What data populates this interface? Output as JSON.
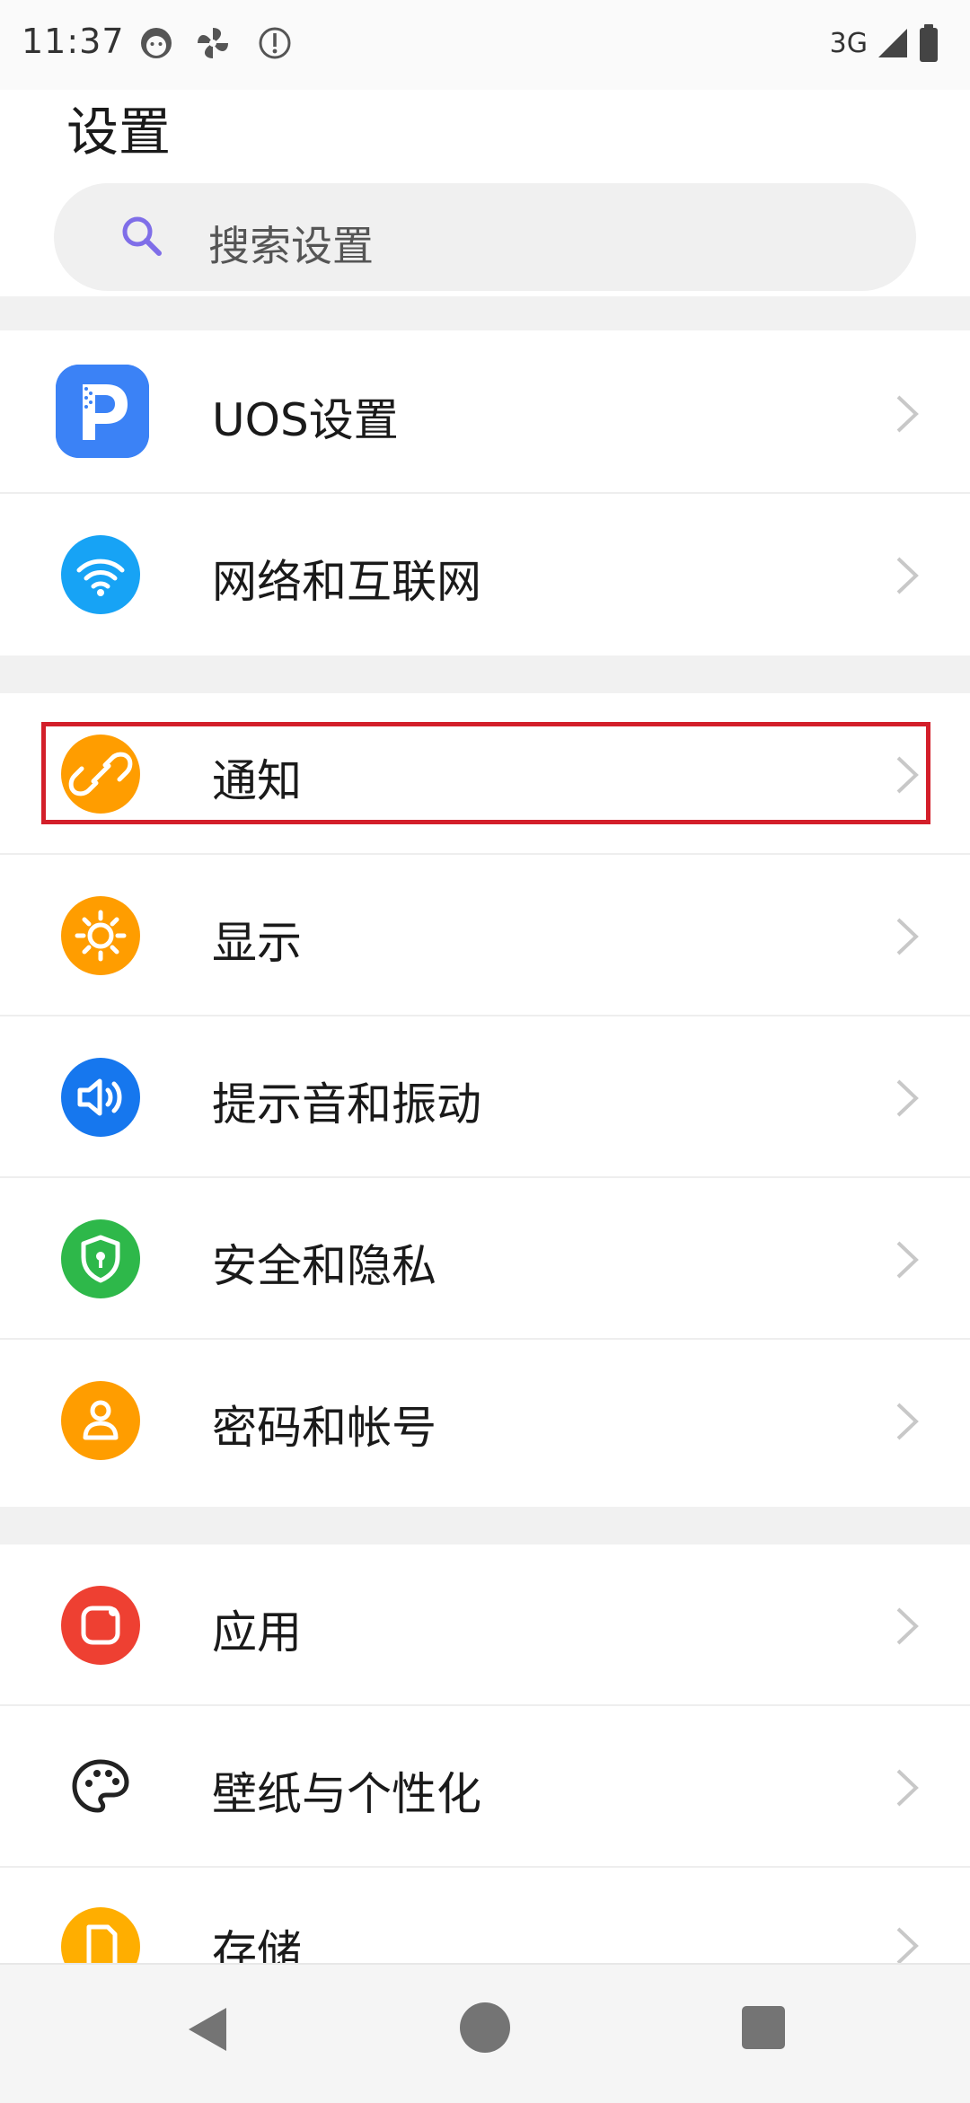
{
  "status_bar": {
    "time": "11:37",
    "network": "3G",
    "icons": [
      "face-icon",
      "pinwheel-icon",
      "alert-icon",
      "signal-icon",
      "battery-icon"
    ]
  },
  "header": {
    "title": "设置"
  },
  "search": {
    "placeholder": "搜索设置"
  },
  "settings": {
    "items": [
      {
        "label": "UOS设置",
        "icon": "uos-app-icon",
        "color": "#3b82f6"
      },
      {
        "label": "网络和互联网",
        "icon": "wifi-icon",
        "color": "#17a3f5"
      },
      {
        "label": "通知",
        "icon": "link-icon",
        "color": "#ff9d00"
      },
      {
        "label": "显示",
        "icon": "sun-icon",
        "color": "#ff9d00"
      },
      {
        "label": "提示音和振动",
        "icon": "volume-icon",
        "color": "#1677ee"
      },
      {
        "label": "安全和隐私",
        "icon": "shield-icon",
        "color": "#2eb84a"
      },
      {
        "label": "密码和帐号",
        "icon": "user-icon",
        "color": "#ff9d00"
      },
      {
        "label": "应用",
        "icon": "app-icon",
        "color": "#ee4032"
      },
      {
        "label": "壁纸与个性化",
        "icon": "palette-icon",
        "color": "#222222"
      },
      {
        "label": "存储",
        "icon": "storage-icon",
        "color": "#ffae00"
      }
    ]
  },
  "highlighted_item": "通知",
  "colors": {
    "highlight_border": "#d31f2a",
    "search_icon": "#7f6ee8"
  },
  "navigation": {
    "buttons": [
      "back-icon",
      "home-icon",
      "recent-apps-icon"
    ]
  }
}
